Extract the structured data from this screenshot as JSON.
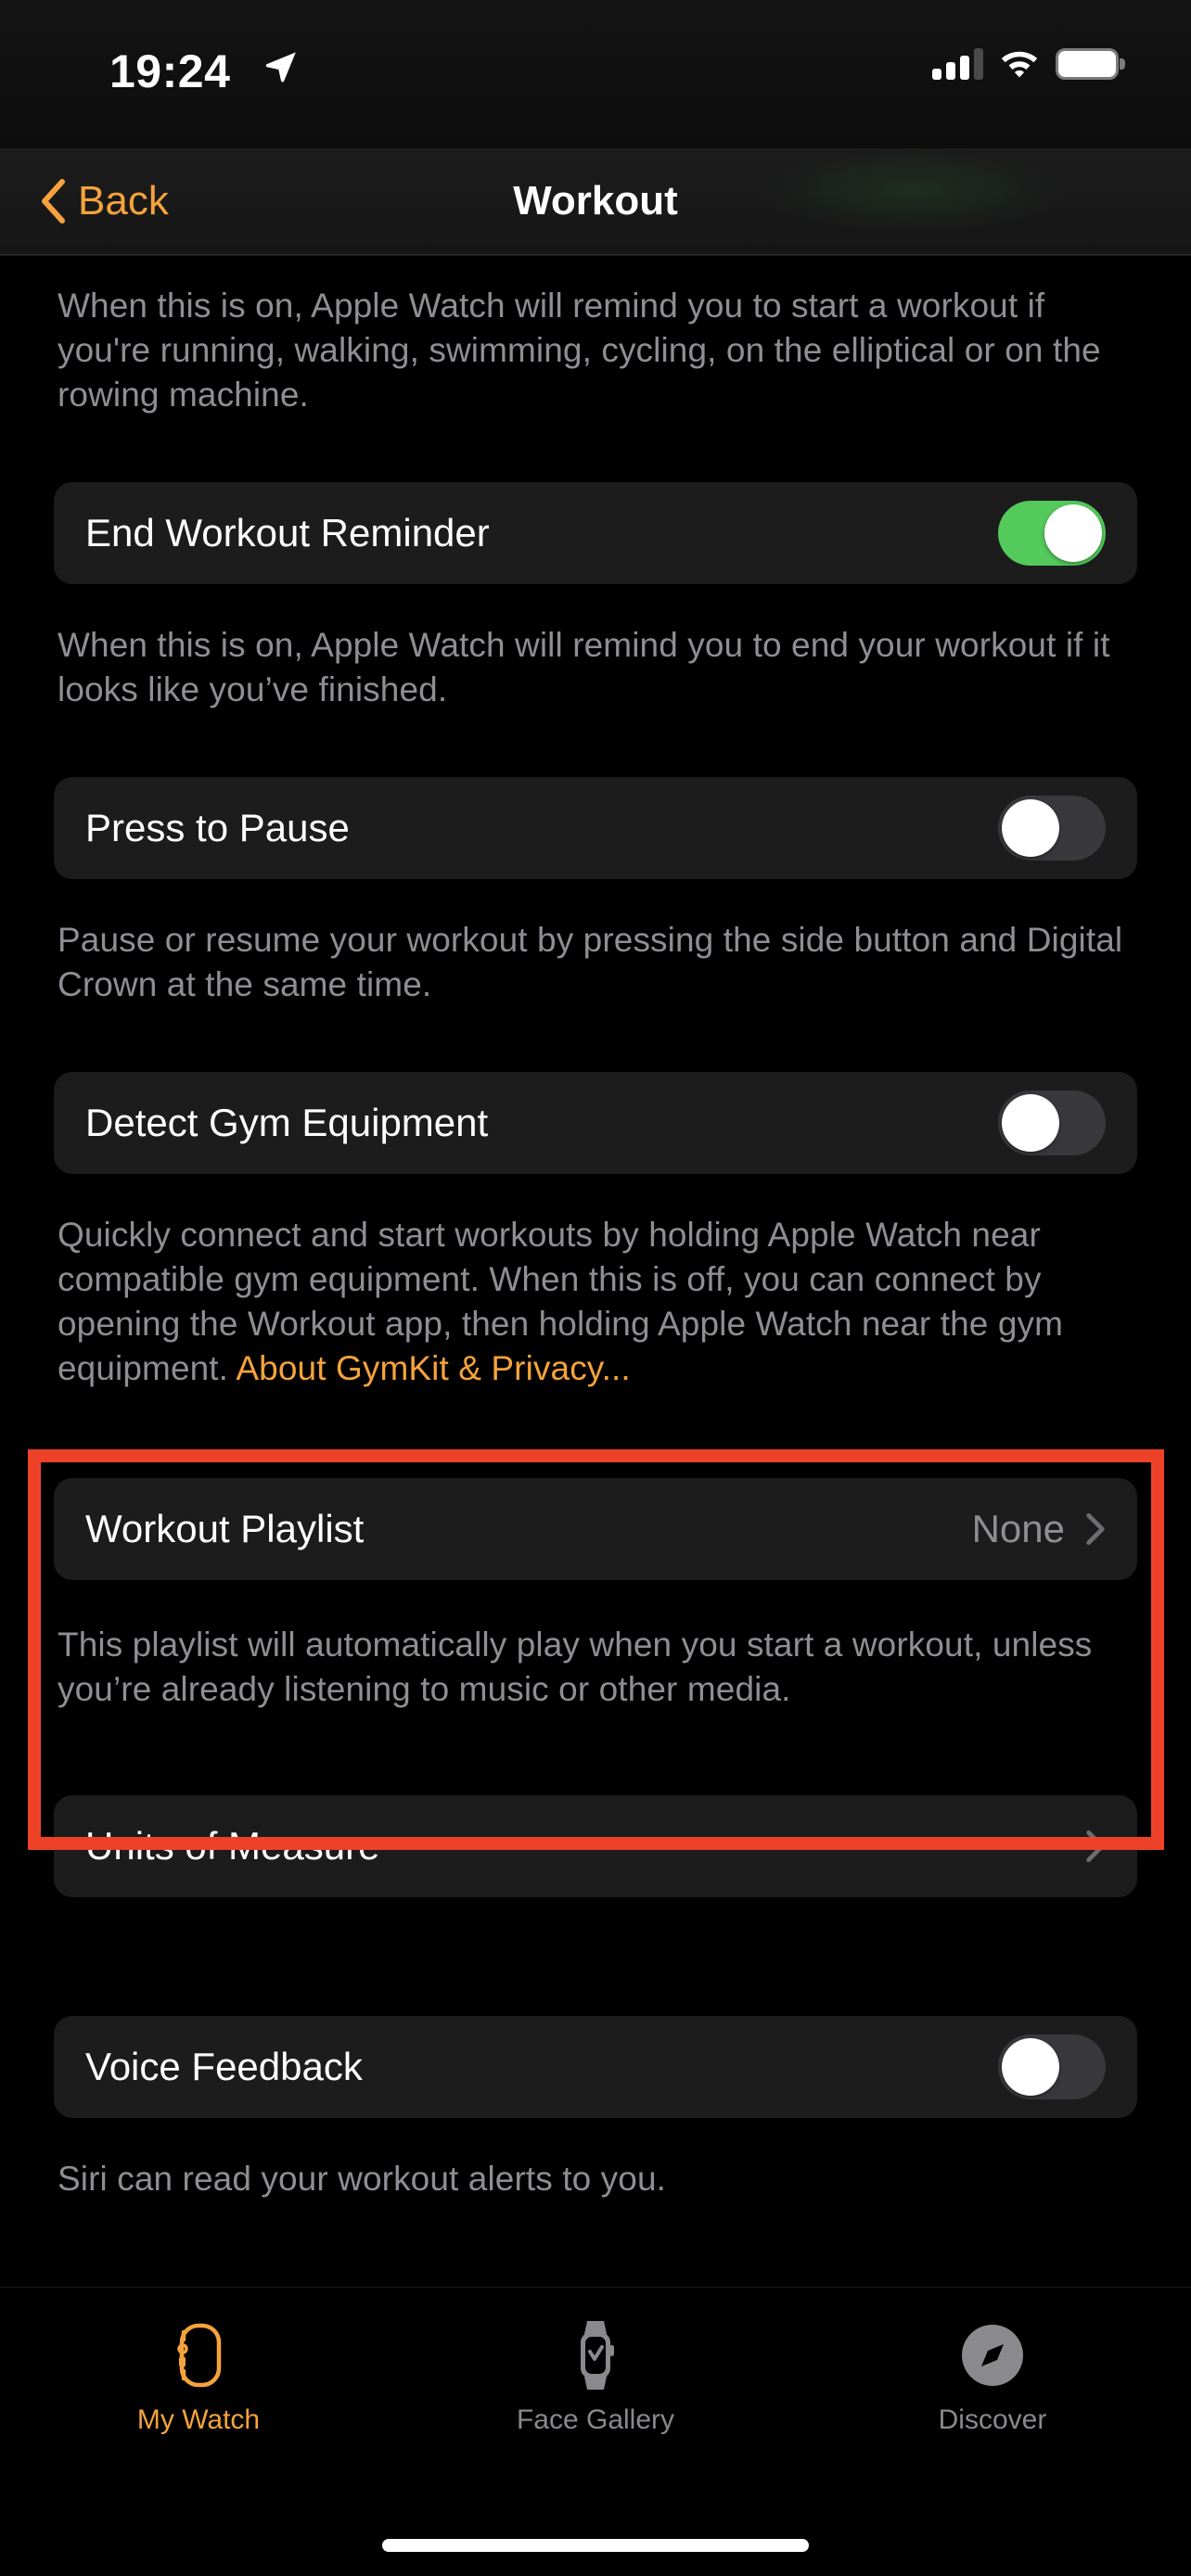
{
  "status_bar": {
    "time": "19:24",
    "location_icon": "location-arrow-icon",
    "cellular_icon": "signal-bars-icon",
    "wifi_icon": "wifi-icon",
    "battery_icon": "battery-full-icon"
  },
  "nav": {
    "back_label": "Back",
    "back_icon": "chevron-left-icon",
    "title": "Workout"
  },
  "sections": {
    "start_reminder_desc": "When this is on, Apple Watch will remind you to start a workout if you're running, walking, swimming, cycling, on the elliptical or on the rowing machine.",
    "end_reminder": {
      "label": "End Workout Reminder",
      "toggle_state": "on",
      "desc": "When this is on, Apple Watch will remind you to end your workout if it looks like you’ve finished."
    },
    "press_to_pause": {
      "label": "Press to Pause",
      "toggle_state": "off",
      "desc": "Pause or resume your workout by pressing the side button and Digital Crown at the same time."
    },
    "detect_gym_equipment": {
      "label": "Detect Gym Equipment",
      "toggle_state": "off",
      "desc_text": "Quickly connect and start workouts by holding Apple Watch near compatible gym equipment. When this is off, you can connect by opening the Workout app, then holding Apple Watch near the gym equipment. ",
      "desc_link": "About GymKit & Privacy..."
    },
    "workout_playlist": {
      "label": "Workout Playlist",
      "value": "None",
      "chevron_icon": "chevron-right-icon",
      "desc": "This playlist will automatically play when you start a workout, unless you’re already listening to music or other media."
    },
    "units_of_measure": {
      "label": "Units of Measure",
      "chevron_icon": "chevron-right-icon"
    },
    "voice_feedback": {
      "label": "Voice Feedback",
      "toggle_state": "off",
      "desc": "Siri can read your workout alerts to you."
    }
  },
  "highlight": {
    "color": "#ee4228",
    "target": "workout-playlist-row"
  },
  "tab_bar": {
    "tabs": [
      {
        "label": "My Watch",
        "icon": "watch-outline-icon",
        "active": true
      },
      {
        "label": "Face Gallery",
        "icon": "watch-check-icon",
        "active": false
      },
      {
        "label": "Discover",
        "icon": "compass-icon",
        "active": false
      }
    ]
  },
  "colors": {
    "accent_orange": "#f5a33c",
    "toggle_on_green": "#54c95c",
    "toggle_off_gray": "#39393d",
    "cell_bg": "#1c1c1d",
    "secondary_text": "#8e8e93",
    "highlight_red": "#ee4228"
  }
}
